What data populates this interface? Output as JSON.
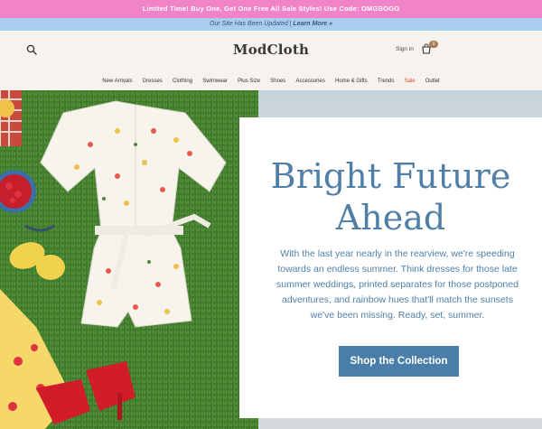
{
  "promo": {
    "text": "Limited Time! Buy One, Get One Free All Sale Styles! Use Code: OMGBOGO"
  },
  "notice": {
    "text": "Our Site Has Been Updated | ",
    "link": "Learn More »"
  },
  "header": {
    "logo": "ModCloth",
    "signin": "Sign in",
    "bag_count": "0",
    "search_icon": "search-icon",
    "bag_icon": "shopping-bag-icon"
  },
  "nav": {
    "items": [
      {
        "label": "New Arrivals"
      },
      {
        "label": "Dresses"
      },
      {
        "label": "Clothing"
      },
      {
        "label": "Swimwear"
      },
      {
        "label": "Plus Size"
      },
      {
        "label": "Shoes"
      },
      {
        "label": "Accessories"
      },
      {
        "label": "Home & Gifts"
      },
      {
        "label": "Trends"
      },
      {
        "label": "Sale"
      },
      {
        "label": "Outlet"
      }
    ],
    "sale_color": "#e0413f"
  },
  "hero": {
    "title_line1": "Bright Future",
    "title_line2": "Ahead",
    "body": "With the last year nearly in the rearview, we're speeding towards an endless summer. Think dresses for those late summer weddings, printed separates for those postponed adventures, and rainbow hues that'll match the sunsets we've been missing. Ready, set, summer.",
    "cta": "Shop the Collection",
    "accent_color": "#4a7ea8"
  },
  "colors": {
    "promo_bg": "#f183c8",
    "notice_bg": "#a9cdec",
    "page_bg": "#f6f3ee",
    "grass": "#3f7a2c"
  }
}
